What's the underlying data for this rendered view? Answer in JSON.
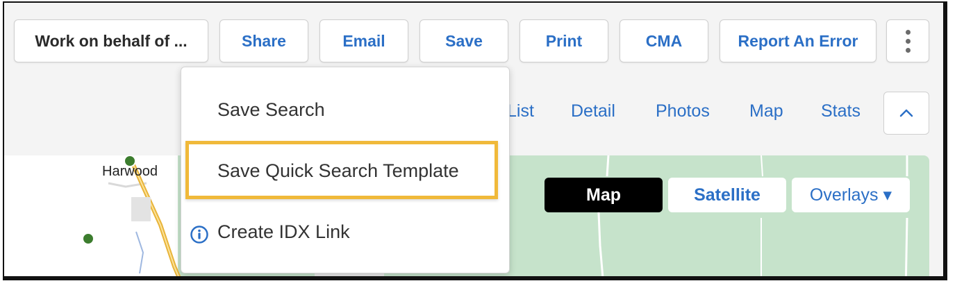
{
  "toolbar": {
    "work_on_behalf": "Work on behalf of ...",
    "share": "Share",
    "email": "Email",
    "save": "Save",
    "print": "Print",
    "cma": "CMA",
    "report_error": "Report An Error"
  },
  "view_tabs": [
    "List",
    "Detail",
    "Photos",
    "Map",
    "Stats"
  ],
  "save_menu": {
    "items": [
      {
        "label": "Save Search"
      },
      {
        "label": "Save Quick Search Template",
        "highlighted": true
      },
      {
        "label": "Create IDX Link",
        "icon": "info-icon"
      }
    ]
  },
  "map": {
    "place_label": "Harwood",
    "type_buttons": [
      "Map",
      "Satellite"
    ],
    "active_type": "Map",
    "overlays_label": "Overlays ▾"
  },
  "colors": {
    "accent": "#2b6fc6",
    "highlight": "#f0b93a",
    "map_green": "#c6e3cb",
    "map_marker": "#3c7d2e"
  }
}
